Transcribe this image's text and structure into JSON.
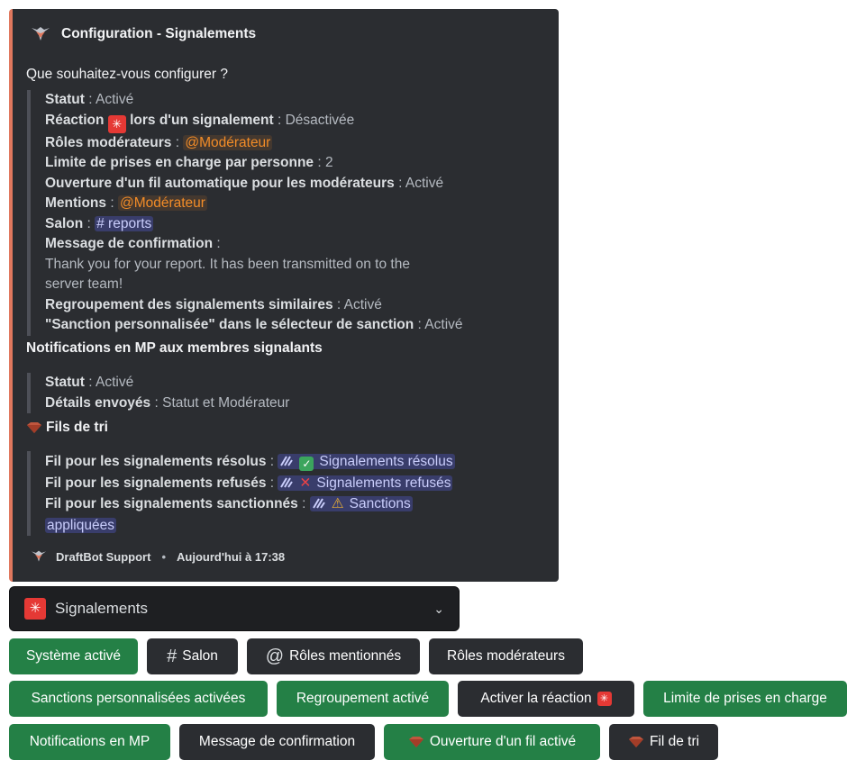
{
  "embed": {
    "title": "Configuration - Signalements",
    "prompt": "Que souhaitez-vous configurer ?",
    "config": {
      "statut_k": "Statut",
      "statut_v": " : Activé",
      "reaction_k1": "Réaction",
      "reaction_k2": "lors d'un signalement",
      "reaction_v": " : Désactivée",
      "roles_k": "Rôles modérateurs",
      "roles_sep": " : ",
      "roles_mention": "@Modérateur",
      "limite_k": "Limite de prises en charge par personne",
      "limite_v": " : 2",
      "ouverture_k": "Ouverture d'un fil automatique pour les modérateurs",
      "ouverture_v": " : Activé",
      "mentions_k": "Mentions",
      "mentions_sep": " : ",
      "mentions_mention": "@Modérateur",
      "salon_k": "Salon",
      "salon_sep": " : ",
      "salon_mention": "# reports",
      "message_k": "Message de confirmation",
      "message_sep": " :",
      "message_v1": "Thank you for your report. It has been transmitted on to the",
      "message_v2": "server team!",
      "regroupement_k": "Regroupement des signalements similaires",
      "regroupement_v": " : Activé",
      "sanction_k": "\"Sanction personnalisée\" dans le sélecteur de sanction",
      "sanction_v": " : Activé"
    },
    "notif_title": "Notifications en MP aux membres signalants",
    "notif": {
      "statut_k": "Statut",
      "statut_v": " : Activé",
      "details_k": "Détails envoyés",
      "details_v": " : Statut et Modérateur"
    },
    "tri_title": "Fils de tri",
    "tri": {
      "resolus_k": "Fil pour les signalements résolus",
      "resolus_sep": " : ",
      "resolus_v": "Signalements résolus",
      "refuses_k": "Fil pour les signalements refusés",
      "refuses_sep": " : ",
      "refuses_v": "Signalements refusés",
      "sanctionnes_k": "Fil pour les signalements sanctionnés",
      "sanctionnes_sep": " : ",
      "sanctionnes_v1": "Sanctions",
      "sanctionnes_v2": "appliquées"
    },
    "footer": {
      "name": "DraftBot Support",
      "sep": "•",
      "time": "Aujourd'hui à 17:38"
    }
  },
  "select": {
    "label": "Signalements"
  },
  "buttons": {
    "systeme": "Système activé",
    "salon": "Salon",
    "roles_mentionnes": "Rôles mentionnés",
    "roles_moderateurs": "Rôles modérateurs",
    "sanctions_perso": "Sanctions personnalisées activées",
    "regroupement": "Regroupement activé",
    "activer_reaction": "Activer la réaction",
    "limite": "Limite de prises en charge",
    "notifications": "Notifications en MP",
    "message_conf": "Message de confirmation",
    "ouverture": "Ouverture d'un fil activé",
    "fil_tri": "Fil de tri"
  },
  "colors": {
    "embed_bg": "#2b2d31",
    "accent": "#e0785e",
    "green_button": "#248046",
    "dark_button": "#2b2d31",
    "role_mention": "#f28c28",
    "channel_mention": "#c9cdfb"
  },
  "icons": {
    "logo": "draftbot-logo-icon",
    "alarm": "rotating-light-icon",
    "gem": "red-gem-icon",
    "thread": "thread-icon",
    "check": "check-mark-icon",
    "cross": "cross-mark-icon",
    "warning": "warning-icon",
    "hash": "hash-icon",
    "at": "at-icon",
    "chevron": "chevron-down-icon"
  }
}
